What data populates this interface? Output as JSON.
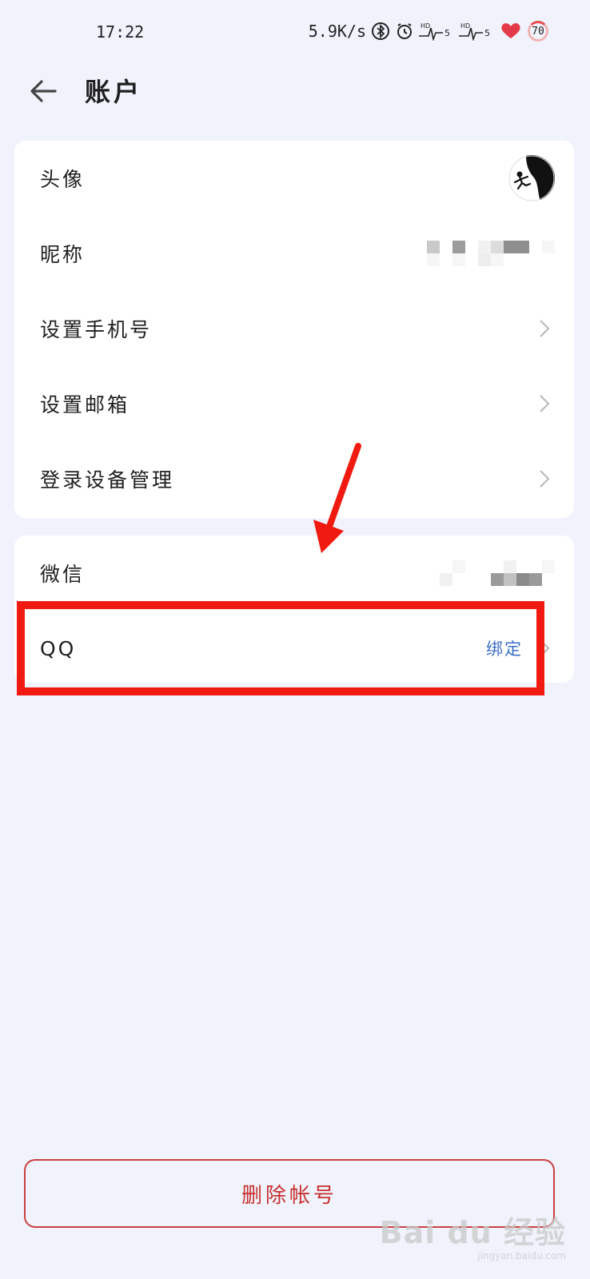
{
  "status_bar": {
    "time": "17:22",
    "net_speed": "5.9K/s",
    "battery": "70",
    "icons": [
      "bluetooth-icon",
      "alarm-icon",
      "signal-hd-icon",
      "signal-hd-icon",
      "heart-icon",
      "battery-ring-icon"
    ]
  },
  "header": {
    "back_icon": "back-arrow-icon",
    "title": "账户"
  },
  "account_items": [
    {
      "label": "头像",
      "value_type": "avatar"
    },
    {
      "label": "昵称",
      "value_type": "blurred"
    },
    {
      "label": "设置手机号",
      "value_type": "chevron"
    },
    {
      "label": "设置邮箱",
      "value_type": "chevron"
    },
    {
      "label": "登录设备管理",
      "value_type": "chevron"
    }
  ],
  "binding_items": [
    {
      "label": "微信",
      "value_type": "blurred"
    },
    {
      "label": "QQ",
      "value": "绑定",
      "value_type": "link-chevron"
    }
  ],
  "delete_button": {
    "label": "删除帐号"
  },
  "watermark": {
    "brand": "Bai du 经验",
    "site": "jingyan.baidu.com"
  },
  "colors": {
    "background": "#f0f3fc",
    "card": "#ffffff",
    "link": "#3c6fc8",
    "danger": "#c8302e",
    "annotation_red": "#f11a10"
  }
}
